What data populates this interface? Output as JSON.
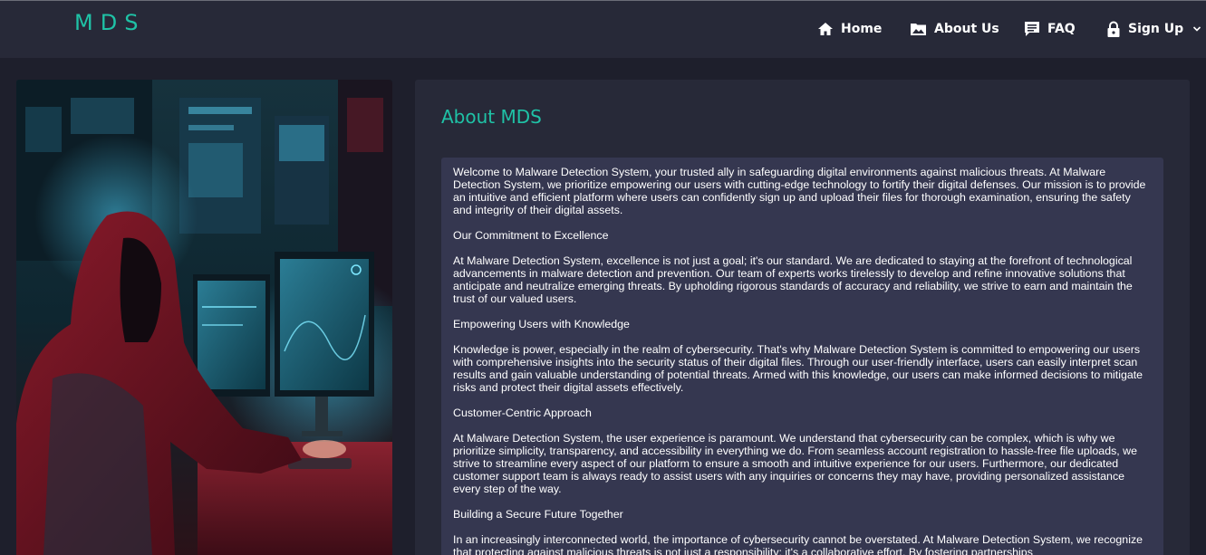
{
  "brand": "MDS",
  "nav": {
    "home": "Home",
    "about": "About Us",
    "faq": "FAQ",
    "signup": "Sign Up"
  },
  "about": {
    "title": "About MDS",
    "paragraphs": [
      "Welcome to Malware Detection System, your trusted ally in safeguarding digital environments against malicious threats. At Malware Detection System, we prioritize empowering our users with cutting-edge technology to fortify their digital defenses. Our mission is to provide an intuitive and efficient platform where users can confidently sign up and upload their files for thorough examination, ensuring the safety and integrity of their digital assets.",
      "Our Commitment to Excellence",
      "At Malware Detection System, excellence is not just a goal; it's our standard. We are dedicated to staying at the forefront of technological advancements in malware detection and prevention. Our team of experts works tirelessly to develop and refine innovative solutions that anticipate and neutralize emerging threats. By upholding rigorous standards of accuracy and reliability, we strive to earn and maintain the trust of our valued users.",
      "Empowering Users with Knowledge",
      "Knowledge is power, especially in the realm of cybersecurity. That's why Malware Detection System is committed to empowering our users with comprehensive insights into the security status of their digital files. Through our user-friendly interface, users can easily interpret scan results and gain valuable understanding of potential threats. Armed with this knowledge, our users can make informed decisions to mitigate risks and protect their digital assets effectively.",
      "Customer-Centric Approach",
      "At Malware Detection System, the user experience is paramount. We understand that cybersecurity can be complex, which is why we prioritize simplicity, transparency, and accessibility in everything we do. From seamless account registration to hassle-free file uploads, we strive to streamline every aspect of our platform to ensure a smooth and intuitive experience for our users. Furthermore, our dedicated customer support team is always ready to assist users with any inquiries or concerns they may have, providing personalized assistance every step of the way.",
      "Building a Secure Future Together",
      "In an increasingly interconnected world, the importance of cybersecurity cannot be overstated. At Malware Detection System, we recognize that protecting against malicious threats is not just a responsibility; it's a collaborative effort. By fostering partnerships"
    ]
  },
  "icons": {
    "home": "home-icon",
    "about": "image-icon",
    "faq": "chat-icon",
    "signup": "lock-icon",
    "dropdown": "chevron-down-icon"
  },
  "colors": {
    "accent": "#1fc2a6",
    "navbar": "#272938",
    "background": "#1e1f2c",
    "text_box": "#353750"
  }
}
